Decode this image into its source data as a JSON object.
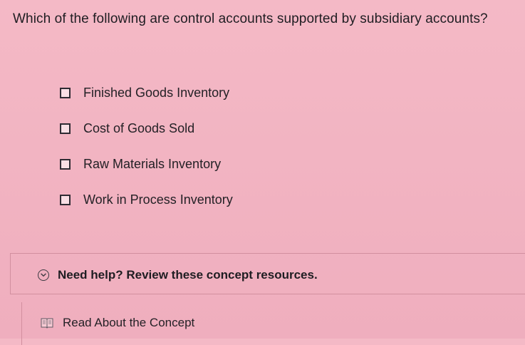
{
  "question": {
    "text": "Which of the following are control accounts supported by subsidiary accounts?"
  },
  "options": [
    {
      "label": "Finished Goods Inventory",
      "checked": false
    },
    {
      "label": "Cost of Goods Sold",
      "checked": false
    },
    {
      "label": "Raw Materials Inventory",
      "checked": false
    },
    {
      "label": "Work in Process Inventory",
      "checked": false
    }
  ],
  "help": {
    "label": "Need help? Review these concept resources.",
    "icon": "chevron-down-circle-icon"
  },
  "resources": {
    "read_label": "Read About the Concept",
    "icon": "book-icon"
  }
}
